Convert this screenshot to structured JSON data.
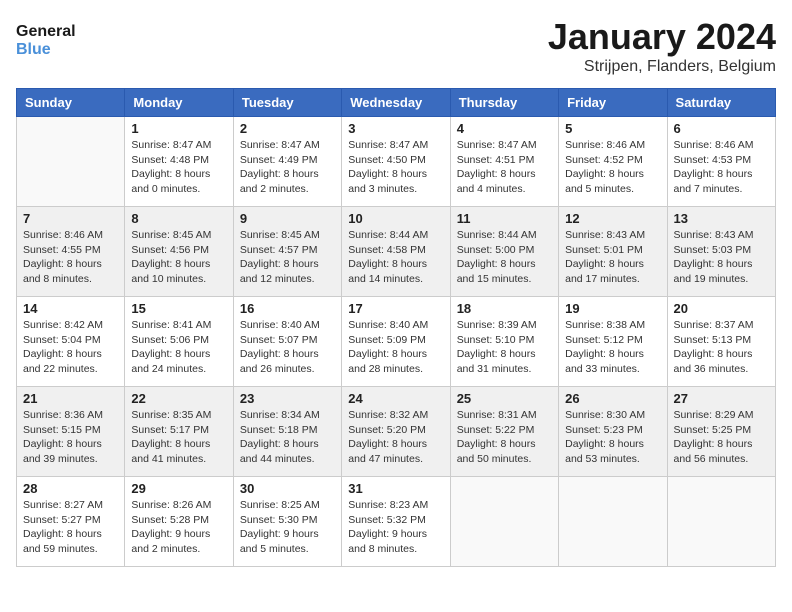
{
  "header": {
    "logo_line1": "General",
    "logo_line2": "Blue",
    "month": "January 2024",
    "location": "Strijpen, Flanders, Belgium"
  },
  "weekdays": [
    "Sunday",
    "Monday",
    "Tuesday",
    "Wednesday",
    "Thursday",
    "Friday",
    "Saturday"
  ],
  "weeks": [
    [
      {
        "day": "",
        "info": ""
      },
      {
        "day": "1",
        "info": "Sunrise: 8:47 AM\nSunset: 4:48 PM\nDaylight: 8 hours\nand 0 minutes."
      },
      {
        "day": "2",
        "info": "Sunrise: 8:47 AM\nSunset: 4:49 PM\nDaylight: 8 hours\nand 2 minutes."
      },
      {
        "day": "3",
        "info": "Sunrise: 8:47 AM\nSunset: 4:50 PM\nDaylight: 8 hours\nand 3 minutes."
      },
      {
        "day": "4",
        "info": "Sunrise: 8:47 AM\nSunset: 4:51 PM\nDaylight: 8 hours\nand 4 minutes."
      },
      {
        "day": "5",
        "info": "Sunrise: 8:46 AM\nSunset: 4:52 PM\nDaylight: 8 hours\nand 5 minutes."
      },
      {
        "day": "6",
        "info": "Sunrise: 8:46 AM\nSunset: 4:53 PM\nDaylight: 8 hours\nand 7 minutes."
      }
    ],
    [
      {
        "day": "7",
        "info": "Sunrise: 8:46 AM\nSunset: 4:55 PM\nDaylight: 8 hours\nand 8 minutes."
      },
      {
        "day": "8",
        "info": "Sunrise: 8:45 AM\nSunset: 4:56 PM\nDaylight: 8 hours\nand 10 minutes."
      },
      {
        "day": "9",
        "info": "Sunrise: 8:45 AM\nSunset: 4:57 PM\nDaylight: 8 hours\nand 12 minutes."
      },
      {
        "day": "10",
        "info": "Sunrise: 8:44 AM\nSunset: 4:58 PM\nDaylight: 8 hours\nand 14 minutes."
      },
      {
        "day": "11",
        "info": "Sunrise: 8:44 AM\nSunset: 5:00 PM\nDaylight: 8 hours\nand 15 minutes."
      },
      {
        "day": "12",
        "info": "Sunrise: 8:43 AM\nSunset: 5:01 PM\nDaylight: 8 hours\nand 17 minutes."
      },
      {
        "day": "13",
        "info": "Sunrise: 8:43 AM\nSunset: 5:03 PM\nDaylight: 8 hours\nand 19 minutes."
      }
    ],
    [
      {
        "day": "14",
        "info": "Sunrise: 8:42 AM\nSunset: 5:04 PM\nDaylight: 8 hours\nand 22 minutes."
      },
      {
        "day": "15",
        "info": "Sunrise: 8:41 AM\nSunset: 5:06 PM\nDaylight: 8 hours\nand 24 minutes."
      },
      {
        "day": "16",
        "info": "Sunrise: 8:40 AM\nSunset: 5:07 PM\nDaylight: 8 hours\nand 26 minutes."
      },
      {
        "day": "17",
        "info": "Sunrise: 8:40 AM\nSunset: 5:09 PM\nDaylight: 8 hours\nand 28 minutes."
      },
      {
        "day": "18",
        "info": "Sunrise: 8:39 AM\nSunset: 5:10 PM\nDaylight: 8 hours\nand 31 minutes."
      },
      {
        "day": "19",
        "info": "Sunrise: 8:38 AM\nSunset: 5:12 PM\nDaylight: 8 hours\nand 33 minutes."
      },
      {
        "day": "20",
        "info": "Sunrise: 8:37 AM\nSunset: 5:13 PM\nDaylight: 8 hours\nand 36 minutes."
      }
    ],
    [
      {
        "day": "21",
        "info": "Sunrise: 8:36 AM\nSunset: 5:15 PM\nDaylight: 8 hours\nand 39 minutes."
      },
      {
        "day": "22",
        "info": "Sunrise: 8:35 AM\nSunset: 5:17 PM\nDaylight: 8 hours\nand 41 minutes."
      },
      {
        "day": "23",
        "info": "Sunrise: 8:34 AM\nSunset: 5:18 PM\nDaylight: 8 hours\nand 44 minutes."
      },
      {
        "day": "24",
        "info": "Sunrise: 8:32 AM\nSunset: 5:20 PM\nDaylight: 8 hours\nand 47 minutes."
      },
      {
        "day": "25",
        "info": "Sunrise: 8:31 AM\nSunset: 5:22 PM\nDaylight: 8 hours\nand 50 minutes."
      },
      {
        "day": "26",
        "info": "Sunrise: 8:30 AM\nSunset: 5:23 PM\nDaylight: 8 hours\nand 53 minutes."
      },
      {
        "day": "27",
        "info": "Sunrise: 8:29 AM\nSunset: 5:25 PM\nDaylight: 8 hours\nand 56 minutes."
      }
    ],
    [
      {
        "day": "28",
        "info": "Sunrise: 8:27 AM\nSunset: 5:27 PM\nDaylight: 8 hours\nand 59 minutes."
      },
      {
        "day": "29",
        "info": "Sunrise: 8:26 AM\nSunset: 5:28 PM\nDaylight: 9 hours\nand 2 minutes."
      },
      {
        "day": "30",
        "info": "Sunrise: 8:25 AM\nSunset: 5:30 PM\nDaylight: 9 hours\nand 5 minutes."
      },
      {
        "day": "31",
        "info": "Sunrise: 8:23 AM\nSunset: 5:32 PM\nDaylight: 9 hours\nand 8 minutes."
      },
      {
        "day": "",
        "info": ""
      },
      {
        "day": "",
        "info": ""
      },
      {
        "day": "",
        "info": ""
      }
    ]
  ]
}
